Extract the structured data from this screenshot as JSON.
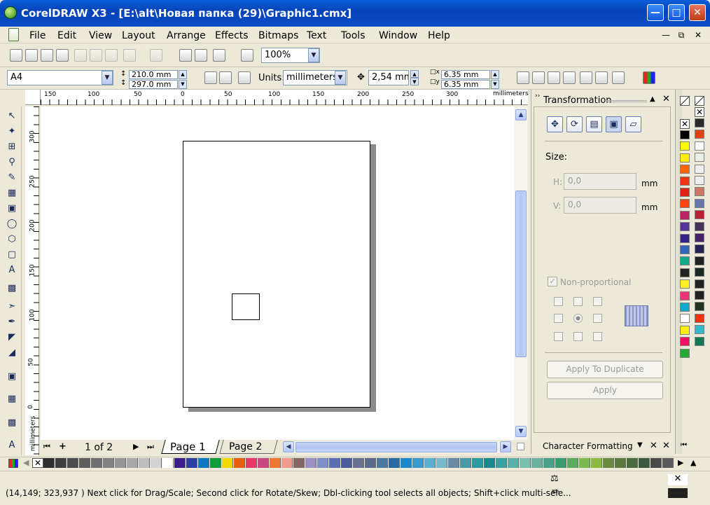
{
  "window": {
    "title": "CorelDRAW X3 - [E:\\alt\\Новая папка (29)\\Graphic1.cmx]"
  },
  "menu": [
    "File",
    "Edit",
    "View",
    "Layout",
    "Arrange",
    "Effects",
    "Bitmaps",
    "Text",
    "Tools",
    "Window",
    "Help"
  ],
  "toolbar": {
    "zoom": "100%"
  },
  "property_bar": {
    "paper_type": "A4",
    "width": "210.0 mm",
    "height": "297.0 mm",
    "units_label": "Units:",
    "units": "millimeters",
    "nudge": "2,54 mm",
    "dup_x": "6.35 mm",
    "dup_y": "6.35 mm"
  },
  "rulers": {
    "h_ticks": [
      "150",
      "100",
      "50",
      "0",
      "50",
      "100",
      "150",
      "200",
      "250",
      "300"
    ],
    "h_unit": "millimeters",
    "v_ticks": [
      "300",
      "250",
      "200",
      "150",
      "100",
      "50",
      "0"
    ],
    "v_unit": "millimeters"
  },
  "navigator": {
    "page_count": "1 of 2",
    "pages": [
      "Page 1",
      "Page 2"
    ]
  },
  "docker": {
    "title": "Transformation",
    "size_label": "Size:",
    "h_label": "H:",
    "h_value": "0,0",
    "v_label": "V:",
    "v_value": "0,0",
    "unit": "mm",
    "non_proportional": "Non-proportional",
    "apply_to_duplicate": "Apply To Duplicate",
    "apply": "Apply",
    "bottom_tab": "Character Formatting"
  },
  "palette_right_colors": [
    "#000000",
    "#2a2a2a",
    "#ffff00",
    "#dd4411",
    "#ffee00",
    "#ffffff",
    "#ff6600",
    "#e8f0e8",
    "#ee3311",
    "#f0eef0",
    "#dd2211",
    "#eeeeee",
    "#ff4411",
    "#cc7766",
    "#bb2266",
    "#6677aa",
    "#553399",
    "#bb2233",
    "#332288",
    "#443355",
    "#3366bb",
    "#442266",
    "#11aa88",
    "#222255",
    "#222222",
    "#222222",
    "#ffee22",
    "#1a2a22",
    "#ee3377",
    "#222222",
    "#11aacc",
    "#222222",
    "#ffffff",
    "#223322",
    "#ffee11",
    "#ee3311",
    "#ee1166",
    "#33bbcc",
    "#22aa33",
    "#117755"
  ],
  "palette_bottom_colors": [
    "#2f2f2f",
    "#3e3e3e",
    "#4e4e4e",
    "#5e5e5e",
    "#707070",
    "#828282",
    "#959595",
    "#a9a9a9",
    "#bdbdbd",
    "#d3d3d3",
    "#ffffff",
    "#3b1e8c",
    "#2f3fa0",
    "#0c79c2",
    "#119b3a",
    "#f1d800",
    "#e65f12",
    "#e43a6a",
    "#c94a80",
    "#ee7733",
    "#f09b8c",
    "#886666",
    "#9a8fc4",
    "#7d8fc4",
    "#5a6fb4",
    "#4a5a9a",
    "#6a7090",
    "#5a6a8a",
    "#4a7aa4",
    "#2a6aa4",
    "#1a8acc",
    "#3a9acc",
    "#5ab0cc",
    "#7ab8cc",
    "#6a8aa4",
    "#4a9aaa",
    "#2a9aa0",
    "#1a8a90",
    "#3aa0a0",
    "#5ab0a8",
    "#7ac0b0",
    "#6ab0a0",
    "#4aa088",
    "#3a9a70",
    "#5aaa60",
    "#7aba50",
    "#8aba40",
    "#6a8a40",
    "#5a7a40",
    "#4a6a40",
    "#3a5a40",
    "#4a4a4a",
    "#5a5a5a"
  ],
  "status": {
    "message": "(14,149; 323,937 ) Next click for Drag/Scale; Second click for Rotate/Skew; Dbl-clicking tool selects all objects; Shift+click multi-sele..."
  }
}
